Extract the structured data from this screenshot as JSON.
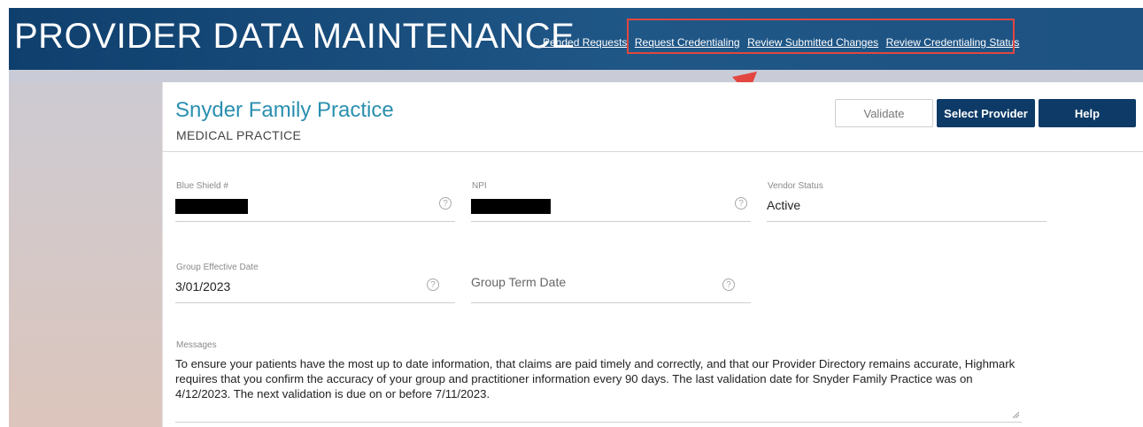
{
  "header": {
    "title": "PROVIDER DATA MAINTENANCE",
    "nav": [
      {
        "label": "Pended Requests"
      },
      {
        "label": "Request Credentialing"
      },
      {
        "label": "Review Submitted Changes"
      },
      {
        "label": "Review Credentialing Status"
      }
    ]
  },
  "practice": {
    "name": "Snyder Family Practice",
    "type": "MEDICAL PRACTICE"
  },
  "buttons": {
    "validate": "Validate",
    "select_provider": "Select Provider",
    "help": "Help"
  },
  "fields": {
    "blue_shield": {
      "label": "Blue Shield #",
      "value": ""
    },
    "npi": {
      "label": "NPI",
      "value": ""
    },
    "vendor_status": {
      "label": "Vendor Status",
      "value": "Active"
    },
    "group_effective_date": {
      "label": "Group Effective Date",
      "value": "3/01/2023"
    },
    "group_term_date": {
      "label": "Group Term Date",
      "value": ""
    }
  },
  "messages": {
    "label": "Messages",
    "text": "To ensure your patients have the most up to date information, that claims are paid timely and correctly, and that our Provider Directory remains accurate, Highmark requires that you confirm the accuracy of your group and practitioner information every 90 days.  The last validation date for Snyder Family Practice was on 4/12/2023.  The next validation is due on or before 7/11/2023."
  },
  "icons": {
    "help": "help-circle-icon",
    "resize": "resize-handle-icon"
  },
  "colors": {
    "header": "#1f5787",
    "title_accent": "#2a8fb0",
    "button_dark": "#0d3a66",
    "annotation": "#e2463f"
  }
}
